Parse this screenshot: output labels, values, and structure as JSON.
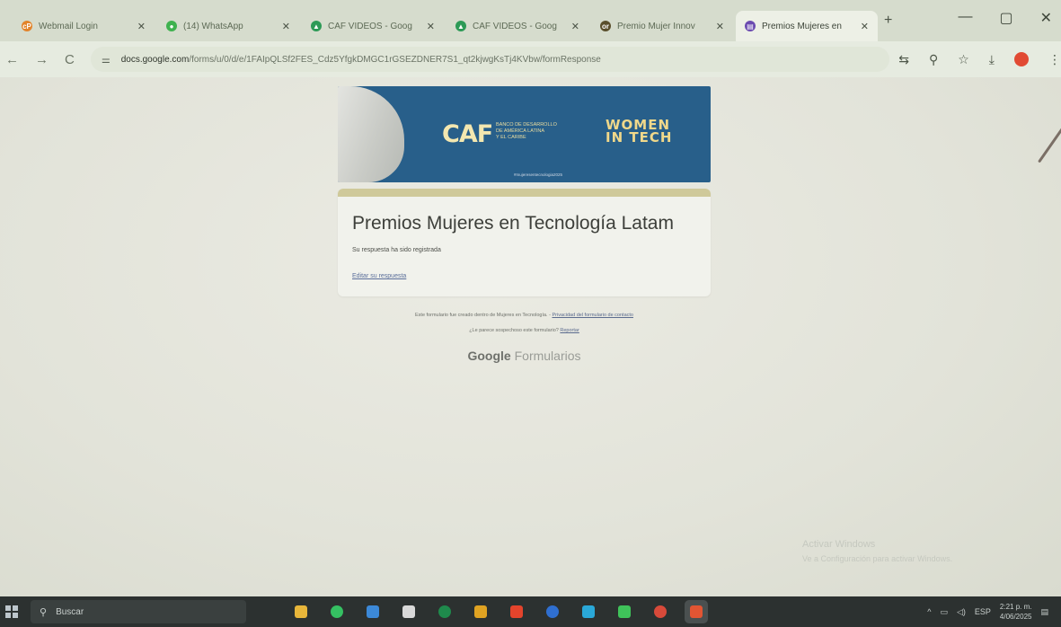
{
  "browser": {
    "tabs": [
      {
        "label": "Webmail Login",
        "icon": "webmail-icon",
        "color": "#e2842b",
        "glyph": "cP"
      },
      {
        "label": "(14) WhatsApp",
        "icon": "whatsapp-icon",
        "color": "#3fb24f",
        "glyph": "●"
      },
      {
        "label": "CAF VIDEOS - Goog",
        "icon": "google-drive-icon",
        "color": "#2d9a56",
        "glyph": "▲"
      },
      {
        "label": "CAF VIDEOS - Goog",
        "icon": "google-drive-icon",
        "color": "#2d9a56",
        "glyph": "▲"
      },
      {
        "label": "Premio Mujer Innov",
        "icon": "site-icon",
        "color": "#5a4f2c",
        "glyph": "or"
      },
      {
        "label": "Premios Mujeres en",
        "icon": "google-forms-icon",
        "color": "#6b4bb0",
        "glyph": "▤"
      }
    ],
    "active_tab_index": 5,
    "new_tab_label": "+",
    "window_controls": {
      "minimize": "—",
      "maximize": "▢",
      "close": "✕"
    },
    "url": {
      "domain": "docs.google.com",
      "path": "/forms/u/0/d/e/1FAIpQLSf2FES_Cdz5YfgkDMGC1rGSEZDNER7S1_qt2kjwgKsTj4KVbw/formResponse"
    },
    "nav": {
      "back": "←",
      "forward": "→",
      "reload": "C"
    }
  },
  "banner": {
    "logo_text": "CAF",
    "org_text": "BANCO DE DESARROLLO\nDE AMÉRICA LATINA\nY EL CARIBE",
    "women_in_tech": "WOMEN\nIN TECH",
    "tagline": "#mujeresentecnologia2025"
  },
  "form": {
    "title": "Premios Mujeres en Tecnología Latam",
    "confirmation": "Su respuesta ha sido registrada",
    "edit_link": "Editar su respuesta"
  },
  "footer": {
    "line1_text": "Este formulario fue creado dentro de Mujeres en Tecnología.",
    "line1_link": "Privacidad del formulario de contacto",
    "line2_text": "¿Le parece sospechoso este formulario?",
    "line2_link": "Reportar",
    "brand_google": "Google",
    "brand_forms": "Formularios"
  },
  "watermark": {
    "line1": "Activar Windows",
    "line2": "Ve a Configuración para activar Windows."
  },
  "taskbar": {
    "search_placeholder": "Buscar",
    "apps": [
      {
        "name": "file-explorer-icon",
        "color": "#e8b63a"
      },
      {
        "name": "spotify-icon",
        "color": "#35c062"
      },
      {
        "name": "app-icon-blue",
        "color": "#3c89d8"
      },
      {
        "name": "store-icon",
        "color": "#d9d9d9"
      },
      {
        "name": "excel-icon",
        "color": "#1f8a4c"
      },
      {
        "name": "chrome-icon",
        "color": "#e0a322"
      },
      {
        "name": "app-icon-red",
        "color": "#e4442c"
      },
      {
        "name": "word-icon",
        "color": "#2f6fd0"
      },
      {
        "name": "edge-icon",
        "color": "#2aa8d8"
      },
      {
        "name": "whatsapp-icon",
        "color": "#3fc35a"
      },
      {
        "name": "app-icon-multi",
        "color": "#d84a3a"
      },
      {
        "name": "chrome-active-icon",
        "color": "#e25533"
      }
    ],
    "tray": {
      "language": "ESP",
      "time": "2:21 p. m.",
      "date": "4/06/2025"
    }
  }
}
